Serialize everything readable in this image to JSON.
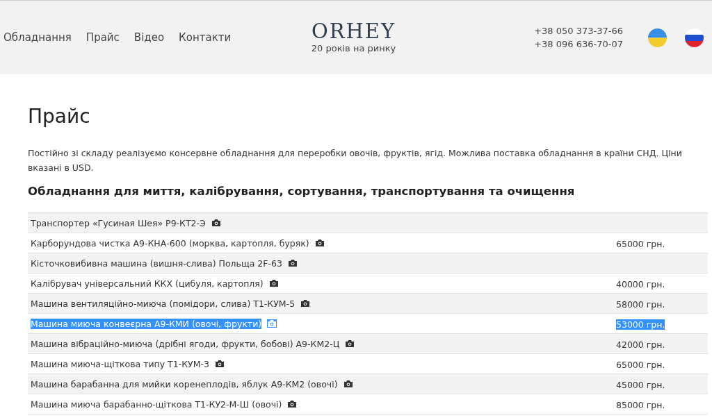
{
  "nav": {
    "items": [
      "Обладнання",
      "Прайс",
      "Відео",
      "Контакти"
    ]
  },
  "logo": {
    "name": "ORHEY",
    "tagline": "20 років на ринку"
  },
  "phones": [
    "+38 050 373-37-66",
    "+38 096 636-70-07"
  ],
  "languages": [
    {
      "kind": "ukraine"
    },
    {
      "kind": "russia"
    }
  ],
  "page": {
    "title": "Прайс",
    "intro": "Постійно зі складу реалізуємо консервне обладнання для переробки овочів, фруктів, ягід. Можлива поставка обладнання в країни СНД. Ціни вказані в USD.",
    "section_title": "Обладнання для миття, калібрування, сортування, транспортування та очищення"
  },
  "table": {
    "rows": [
      {
        "name": "Транспортер «Гусиная Шея» Р9-КТ2-Э",
        "selected": false
      },
      {
        "name": "Карборундова чистка А9-КНА-600 (морква, картопля, буряк)",
        "price": "65000 грн.",
        "selected": false
      },
      {
        "name": "Кісточковибивна машина (вишня-слива) Польща 2F-63",
        "selected": false
      },
      {
        "name": "Калібрувач універсальний ККХ (цибуля, картопля)",
        "price": "40000 грн.",
        "selected": false
      },
      {
        "name": "Машина вентиляційно-миюча (помідори, слива) Т1-КУМ-5",
        "price": "58000 грн.",
        "selected": false
      },
      {
        "name": "Машина миюча конвеєрна А9-КМИ (овочі, фрукти)",
        "price": "53000 грн.",
        "selected": true
      },
      {
        "name": "Машина вібраційно-миюча (дрібні ягоди, фрукти, бобові) А9-КМ2-Ц",
        "price": "42000 грн.",
        "selected": false
      },
      {
        "name": "Машина миюча-щіткова типу Т1-КУМ-3",
        "price": "65000 грн.",
        "selected": false
      },
      {
        "name": "Машина барабанна для мийки коренеплодів, яблук А9-КМ2 (овочі)",
        "price": "45000 грн.",
        "selected": false
      },
      {
        "name": "Машина миюча барабанно-щіткова Т1-КУ2-М-Ш (овочі)",
        "price": "85000 грн.",
        "selected": false
      }
    ]
  }
}
